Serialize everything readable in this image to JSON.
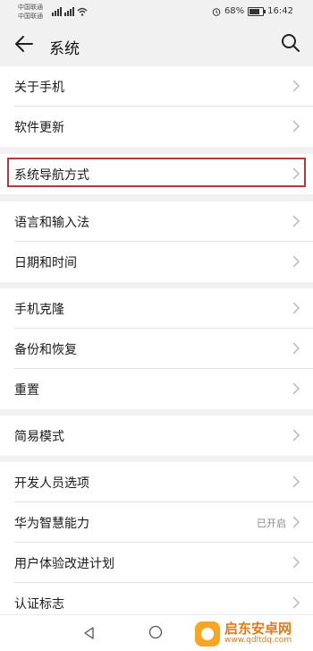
{
  "status_bar": {
    "carrier_1": "中国联通",
    "carrier_2": "中国联通",
    "battery": "68%",
    "battery_level": 0.68,
    "time": "16:42"
  },
  "header": {
    "title": "系统"
  },
  "groups": [
    {
      "items": [
        {
          "label": "关于手机"
        },
        {
          "label": "软件更新"
        }
      ]
    },
    {
      "items": [
        {
          "label": "系统导航方式"
        }
      ]
    },
    {
      "items": [
        {
          "label": "语言和输入法"
        },
        {
          "label": "日期和时间"
        }
      ]
    },
    {
      "items": [
        {
          "label": "手机克隆"
        },
        {
          "label": "备份和恢复"
        },
        {
          "label": "重置"
        }
      ]
    },
    {
      "items": [
        {
          "label": "简易模式"
        }
      ]
    },
    {
      "items": [
        {
          "label": "开发人员选项"
        },
        {
          "label": "华为智慧能力",
          "value": "已开启"
        },
        {
          "label": "用户体验改进计划"
        },
        {
          "label": "认证标志"
        }
      ]
    }
  ],
  "watermark": {
    "name": "启东安卓网",
    "url": "www.qdltdq.com"
  },
  "colors": {
    "background": "#f1f1f1",
    "highlight_border": "#b03b3b"
  }
}
